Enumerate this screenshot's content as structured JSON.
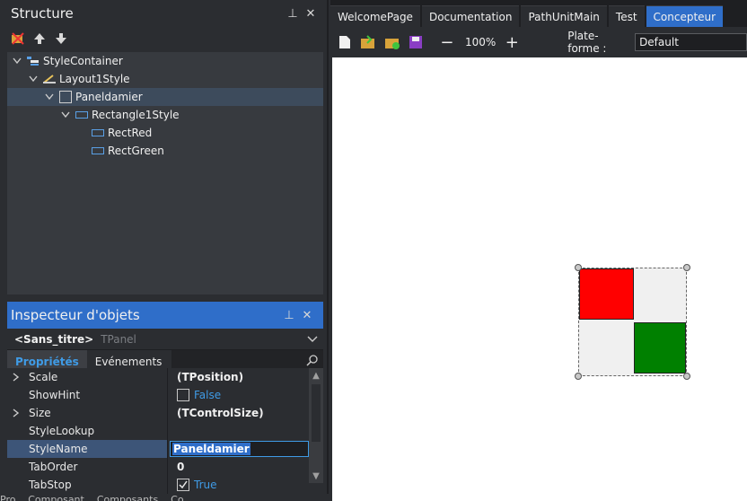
{
  "structure": {
    "title": "Structure",
    "pin": "📌",
    "close": "✕",
    "tree": [
      {
        "label": "StyleContainer",
        "icon": "style-container-icon",
        "expanded": true,
        "depth": 0
      },
      {
        "label": "Layout1Style",
        "icon": "layout-icon",
        "expanded": true,
        "depth": 1
      },
      {
        "label": "Paneldamier",
        "icon": "panel-icon",
        "expanded": true,
        "depth": 2,
        "selected": true
      },
      {
        "label": "Rectangle1Style",
        "icon": "rectangle-icon",
        "expanded": true,
        "depth": 3
      },
      {
        "label": "RectRed",
        "icon": "rectangle-icon",
        "depth": 4
      },
      {
        "label": "RectGreen",
        "icon": "rectangle-icon",
        "depth": 4
      }
    ]
  },
  "inspector": {
    "title": "Inspecteur d'objets",
    "object_name": "<Sans_titre>",
    "object_type": "TPanel",
    "tabs": [
      "Propriétés",
      "Evénements"
    ],
    "properties": [
      {
        "name": "Scale",
        "value": "(TPosition)",
        "expandable": true
      },
      {
        "name": "ShowHint",
        "value": "False",
        "checkbox": true,
        "checked": false
      },
      {
        "name": "Size",
        "value": "(TControlSize)",
        "expandable": true
      },
      {
        "name": "StyleLookup",
        "value": ""
      },
      {
        "name": "StyleName",
        "value": "Paneldamier",
        "selected": true
      },
      {
        "name": "TabOrder",
        "value": "0"
      },
      {
        "name": "TabStop",
        "value": "True",
        "checkbox": true,
        "checked": true
      }
    ]
  },
  "bottom_tabs": [
    "Pro...",
    "Composant...",
    "Composants...",
    "Co..."
  ],
  "document_tabs": [
    "WelcomePage",
    "Documentation",
    "PathUnitMain",
    "Test",
    "Concepteur"
  ],
  "active_document_tab": "Concepteur",
  "designer": {
    "zoom": "100%",
    "platform_label": "Plate-forme :",
    "platform_value": "Default"
  },
  "colors": {
    "accent": "#2f6ec9",
    "rect_red": "#ff0000",
    "rect_green": "#008000",
    "panel_bg": "#f0f0f0"
  }
}
